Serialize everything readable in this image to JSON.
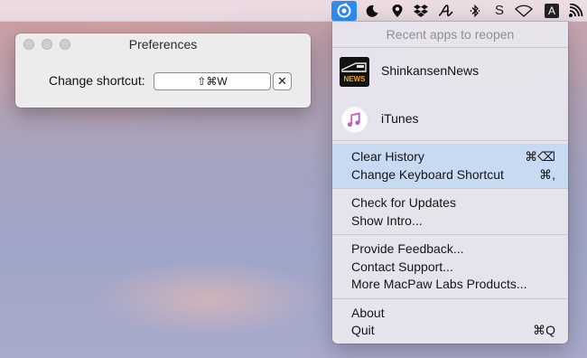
{
  "menubar": {
    "icons": [
      "setapp-active-icon",
      "moon-icon",
      "location-pin-icon",
      "dropbox-icon",
      "script-a-icon",
      "bluetooth-icon",
      "skype-icon",
      "wifi-icon",
      "input-source-icon",
      "wifi-waves-icon"
    ],
    "skype_glyph": "S",
    "input_source_glyph": "A"
  },
  "preferences": {
    "title": "Preferences",
    "shortcut_label": "Change shortcut:",
    "shortcut_value": "⇧⌘W",
    "clear_glyph": "✕"
  },
  "menu": {
    "header": "Recent apps to reopen",
    "recent_apps": [
      {
        "name": "ShinkansenNews",
        "icon": "shinkansen-news-icon"
      },
      {
        "name": "iTunes",
        "icon": "itunes-icon"
      }
    ],
    "groups": [
      [
        {
          "label": "Clear History",
          "shortcut": "⌘⌫"
        },
        {
          "label": "Change Keyboard Shortcut",
          "shortcut": "⌘,"
        }
      ],
      [
        {
          "label": "Check for Updates",
          "shortcut": ""
        },
        {
          "label": "Show Intro...",
          "shortcut": ""
        }
      ],
      [
        {
          "label": "Provide Feedback...",
          "shortcut": ""
        },
        {
          "label": "Contact Support...",
          "shortcut": ""
        },
        {
          "label": "More MacPaw Labs Products...",
          "shortcut": ""
        }
      ],
      [
        {
          "label": "About",
          "shortcut": ""
        },
        {
          "label": "Quit",
          "shortcut": "⌘Q"
        }
      ]
    ]
  },
  "colors": {
    "accent": "#2f8bf0",
    "menu_highlight": "#c8daf2"
  },
  "news_icon_text": "NEWS"
}
